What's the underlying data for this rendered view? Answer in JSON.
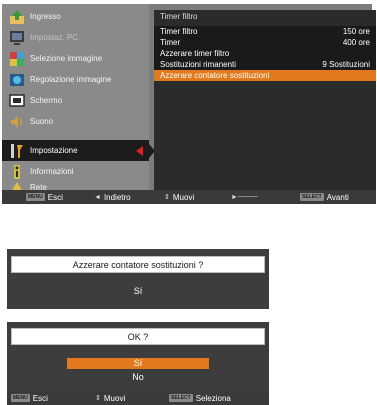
{
  "sidebar": {
    "items": [
      {
        "label": "Ingresso",
        "icon": "input-icon",
        "dim": false,
        "active": false
      },
      {
        "label": "Impostaz. PC",
        "icon": "pc-settings-icon",
        "dim": true,
        "active": false
      },
      {
        "label": "Selezione immagine",
        "icon": "image-select-icon",
        "dim": false,
        "active": false
      },
      {
        "label": "Regolazione immagine",
        "icon": "image-adjust-icon",
        "dim": false,
        "active": false
      },
      {
        "label": "Schermo",
        "icon": "screen-icon",
        "dim": false,
        "active": false
      },
      {
        "label": "Suono",
        "icon": "sound-icon",
        "dim": false,
        "active": false
      },
      {
        "label": "Impostazione",
        "icon": "settings-icon",
        "dim": false,
        "active": true
      },
      {
        "label": "Informazioni",
        "icon": "info-icon",
        "dim": false,
        "active": false
      },
      {
        "label": "Rete",
        "icon": "network-icon",
        "dim": false,
        "active": false
      }
    ]
  },
  "panel": {
    "title": "Timer filtro",
    "rows": [
      {
        "label": "Timer filtro",
        "value": "150 ore"
      },
      {
        "label": "Timer",
        "value": "400 ore"
      },
      {
        "label": "Azzerare timer filtro",
        "value": ""
      },
      {
        "label": "Sostituzioni rimanenti",
        "value": "9 Sostituzioni"
      },
      {
        "label": "Azzerare contatore sostituzioni",
        "value": "",
        "selected": true
      }
    ]
  },
  "osd_footer": {
    "menu_key": "MENU",
    "menu_label": "Esci",
    "back_label": "Indietro",
    "move_label": "Muovi",
    "select_key": "SELECT",
    "select_label": "Avanti"
  },
  "dialog1": {
    "question": "Azzerare contatore sostituzioni ?",
    "option": "Sí"
  },
  "dialog2": {
    "question": "OK ?",
    "options": [
      "Sí",
      "No"
    ]
  },
  "dialog_footer": {
    "menu_key": "MENU",
    "menu_label": "Esci",
    "move_label": "Muovi",
    "select_key": "SELECT",
    "select_label": "Seleziona"
  },
  "colors": {
    "highlight": "#e07a1c",
    "arrow": "#e02020"
  }
}
